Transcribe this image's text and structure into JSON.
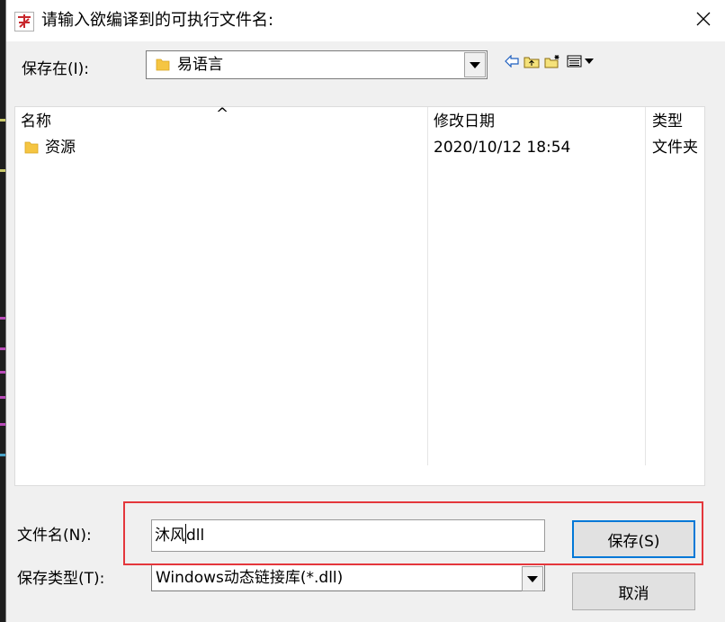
{
  "dialog": {
    "title": "请输入欲编译到的可执行文件名:",
    "close_glyph": "✕"
  },
  "save_in": {
    "label": "保存在(I):",
    "folder": "易语言"
  },
  "file_list": {
    "columns": {
      "name": "名称",
      "modified": "修改日期",
      "type": "类型"
    },
    "sort_indicator": "^",
    "rows": [
      {
        "name": "资源",
        "modified": "2020/10/12 18:54",
        "type": "文件夹"
      }
    ]
  },
  "file_name": {
    "label": "文件名(N):",
    "value_before_caret": "沐风",
    "value_after_caret": "dll"
  },
  "save_type": {
    "label": "保存类型(T):",
    "value": "Windows动态链接库(*.dll)"
  },
  "buttons": {
    "save": "保存(S)",
    "cancel": "取消"
  },
  "colors": {
    "highlight_border": "#e4373c",
    "primary_button_border": "#0078d7",
    "folder_yellow": "#f5c542"
  },
  "icons": {
    "app": "eyuyan-app-icon",
    "folder": "folder-icon",
    "back": "back-arrow-icon",
    "up": "up-folder-icon",
    "new_folder": "new-folder-icon",
    "view_menu": "view-menu-icon"
  }
}
